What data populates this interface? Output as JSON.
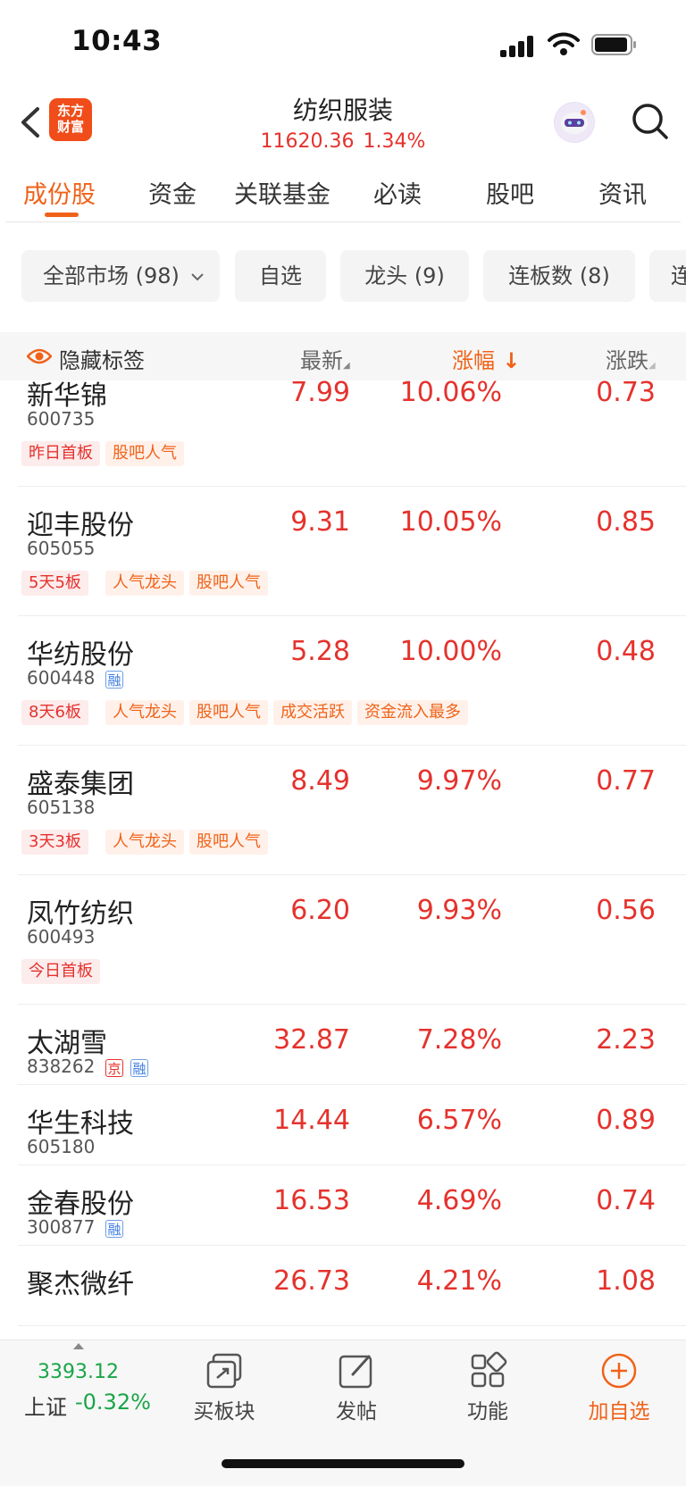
{
  "status_bar": {
    "time": "10:43"
  },
  "header": {
    "logo_text_1": "东方",
    "logo_text_2": "财富",
    "title": "纺织服装",
    "index_value": "11620.36",
    "index_change": "1.34%"
  },
  "tabs": [
    {
      "label": "成份股",
      "active": true
    },
    {
      "label": "资金"
    },
    {
      "label": "关联基金"
    },
    {
      "label": "必读"
    },
    {
      "label": "股吧"
    },
    {
      "label": "资讯"
    }
  ],
  "filters": [
    {
      "label": "全部市场 (98)"
    },
    {
      "label": "自选"
    },
    {
      "label": "龙头 (9)"
    },
    {
      "label": "连板数 (8)"
    },
    {
      "label": "连"
    }
  ],
  "table_header": {
    "hide_tags": "隐藏标签",
    "col_latest": "最新",
    "col_change_pct": "涨幅",
    "col_change": "涨跌"
  },
  "rows": [
    {
      "name": "新华锦",
      "code": "600735",
      "latest": "7.99",
      "pct": "10.06%",
      "change": "0.73",
      "tags": [
        {
          "text": "昨日首板",
          "style": "red"
        },
        {
          "text": "股吧人气",
          "style": "orange"
        }
      ]
    },
    {
      "name": "迎丰股份",
      "code": "605055",
      "latest": "9.31",
      "pct": "10.05%",
      "change": "0.85",
      "tags": [
        {
          "text": "5天5板",
          "style": "red"
        },
        {
          "text": "人气龙头",
          "style": "orange"
        },
        {
          "text": "股吧人气",
          "style": "orange"
        }
      ]
    },
    {
      "name": "华纺股份",
      "code": "600448",
      "badge": "融",
      "latest": "5.28",
      "pct": "10.00%",
      "change": "0.48",
      "tags": [
        {
          "text": "8天6板",
          "style": "red"
        },
        {
          "text": "人气龙头",
          "style": "orange"
        },
        {
          "text": "股吧人气",
          "style": "orange"
        },
        {
          "text": "成交活跃",
          "style": "orange"
        },
        {
          "text": "资金流入最多",
          "style": "orange"
        }
      ]
    },
    {
      "name": "盛泰集团",
      "code": "605138",
      "latest": "8.49",
      "pct": "9.97%",
      "change": "0.77",
      "tags": [
        {
          "text": "3天3板",
          "style": "red"
        },
        {
          "text": "人气龙头",
          "style": "orange"
        },
        {
          "text": "股吧人气",
          "style": "orange"
        }
      ]
    },
    {
      "name": "凤竹纺织",
      "code": "600493",
      "latest": "6.20",
      "pct": "9.93%",
      "change": "0.56",
      "tags": [
        {
          "text": "今日首板",
          "style": "red"
        }
      ]
    },
    {
      "name": "太湖雪",
      "code": "838262",
      "badge_jing": "京",
      "badge": "融",
      "latest": "32.87",
      "pct": "7.28%",
      "change": "2.23",
      "tags": []
    },
    {
      "name": "华生科技",
      "code": "605180",
      "latest": "14.44",
      "pct": "6.57%",
      "change": "0.89",
      "tags": []
    },
    {
      "name": "金春股份",
      "code": "300877",
      "badge": "融",
      "latest": "16.53",
      "pct": "4.69%",
      "change": "0.74",
      "tags": []
    },
    {
      "name": "聚杰微纤",
      "code": "",
      "latest": "26.73",
      "pct": "4.21%",
      "change": "1.08",
      "tags": []
    }
  ],
  "bottom_bar": {
    "index_value": "3393.12",
    "index_name": "上证",
    "index_pct": "-0.32%",
    "buttons": [
      {
        "label": "买板块",
        "icon": "buy-sector-icon"
      },
      {
        "label": "发帖",
        "icon": "compose-icon"
      },
      {
        "label": "功能",
        "icon": "grid-icon"
      },
      {
        "label": "加自选",
        "icon": "plus-circle-icon"
      }
    ]
  },
  "colors": {
    "accent": "#f06218",
    "up": "#e5322d",
    "down": "#1aa548"
  }
}
